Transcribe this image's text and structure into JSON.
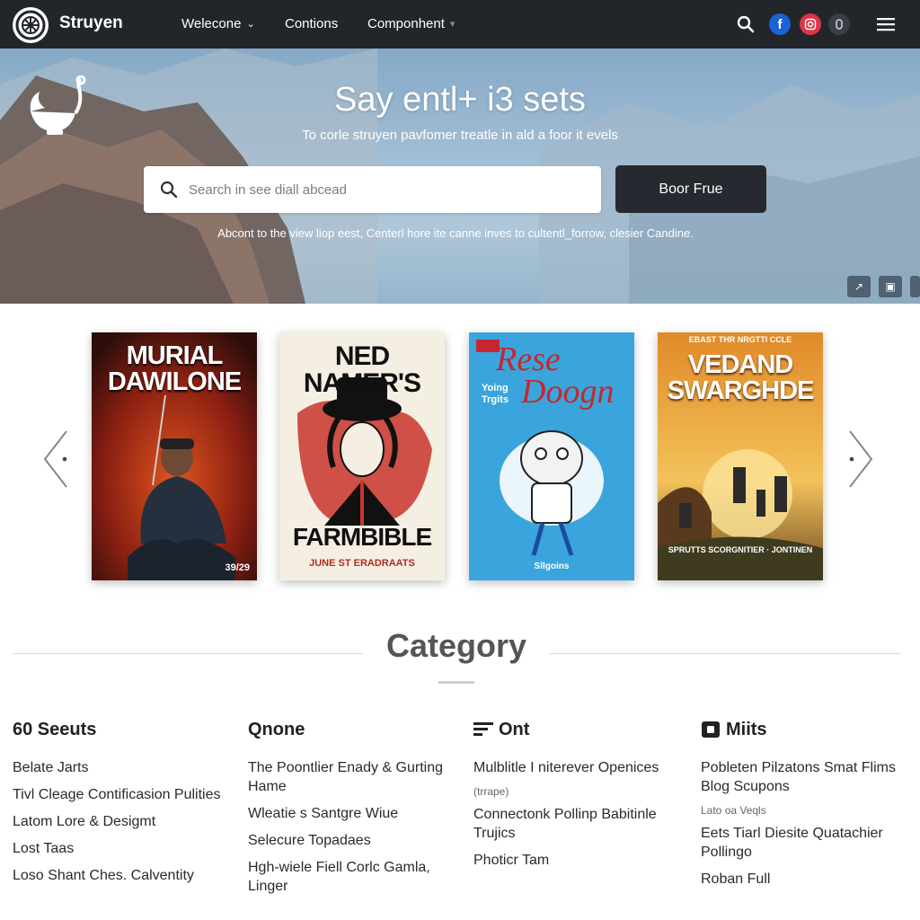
{
  "header": {
    "brand": "Struyen",
    "nav": [
      {
        "label": "Welecone",
        "has_chevron": true
      },
      {
        "label": "Contions",
        "has_chevron": false
      },
      {
        "label": "Componhent",
        "has_chevron": true
      }
    ],
    "icons": [
      "search-icon",
      "facebook-icon",
      "instagram-icon",
      "extra-icon",
      "menu-icon"
    ],
    "colors": {
      "bar": "#22262b",
      "facebook": "#1a63d6",
      "instagram": "#e03348"
    }
  },
  "hero": {
    "title": "Say entl+ i3 sets",
    "subtitle": "To corle struyen pavfomer treatle in ald a foor it evels",
    "search": {
      "placeholder": "Search in see diall abcead",
      "value": ""
    },
    "button": "Boor Frue",
    "note": "Abcont to the view liop eest, Centerl hore ite canne inves to cultentl_forrow, clesier Candine."
  },
  "carousel": {
    "books": [
      {
        "title_lines": [
          "MURIAL",
          "DAWILONE"
        ],
        "top_text": "",
        "bottom_text": "39/29"
      },
      {
        "title_lines": [
          "NED NAMER'S"
        ],
        "bottom_title": "FARMBIBLE",
        "bottom_text": "JUNE ST ERADRAATS"
      },
      {
        "title_lines": [
          "Rese",
          "Doogn"
        ],
        "top_text": "",
        "side_text": "Yoing Trgits",
        "bottom_text": "Sllgoins"
      },
      {
        "title_lines": [
          "VEDAND",
          "SWARGHDE"
        ],
        "top_text": "EBAST THR NRGTTI CCLE",
        "bottom_text": "SPRUTTS SCORGNITIER · JONTINEN"
      }
    ]
  },
  "category": {
    "title": "Category",
    "columns": [
      {
        "icon": "book-icon",
        "heading": "60 Seeuts",
        "items": [
          {
            "text": "Belate Jarts"
          },
          {
            "text": "Tivl Cleage Contificasion Pulities"
          },
          {
            "text": "Latom Lore & Desigmt"
          },
          {
            "text": "Lost Taas"
          },
          {
            "text": "Loso Shant Ches. Calventity"
          }
        ]
      },
      {
        "icon": "",
        "heading": "Qnone",
        "items": [
          {
            "text": "The Poontlier Enady & Gurting Hame"
          },
          {
            "text": "Wleatie s Santgre Wiue"
          },
          {
            "text": "Selecure Topadaes"
          },
          {
            "text": "Hgh-wiele Fiell Corlc Gamla, Linger"
          }
        ]
      },
      {
        "icon": "list-icon",
        "heading": "Ont",
        "items": [
          {
            "text": "Mulblitle I niterever Openices"
          },
          {
            "text": "(trrape)",
            "small": true
          },
          {
            "text": "Connectonk Pollinp Babitinle Trujics"
          },
          {
            "text": "Photicr Tam"
          }
        ]
      },
      {
        "icon": "tag-icon",
        "heading": "Miits",
        "items": [
          {
            "text": "Pobleten Pilzatons Smat Flims Blog Scupons"
          },
          {
            "text": "Lato oa Veqls",
            "small": true
          },
          {
            "text": "Eets Tiarl Diesite Quatachier Pollingo"
          },
          {
            "text": "Roban Full"
          }
        ]
      }
    ]
  }
}
